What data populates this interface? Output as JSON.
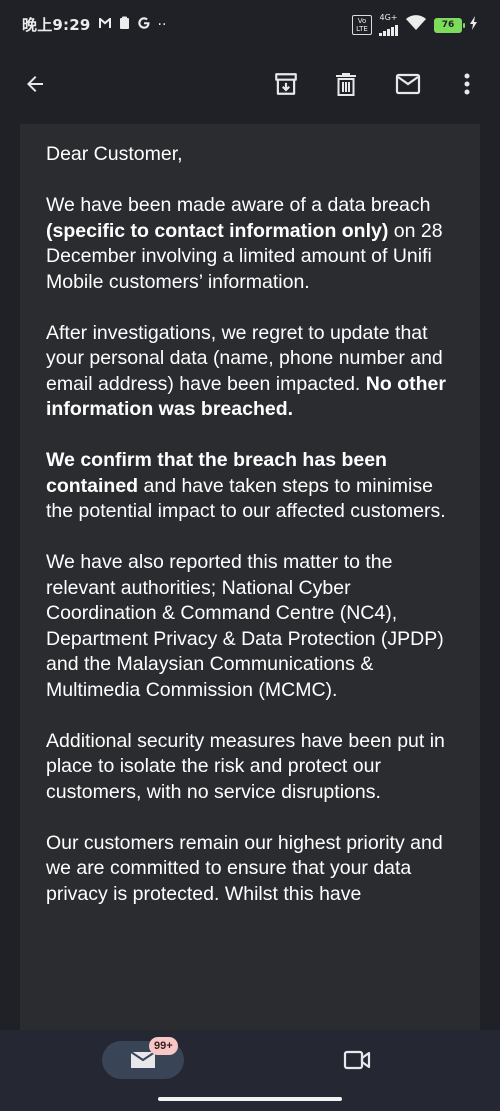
{
  "status_bar": {
    "time": "晚上9:29",
    "volte": "Vo LTE",
    "network": "4G+",
    "battery": "76"
  },
  "app_bar": {
    "back_icon": "arrow-left-icon",
    "archive_icon": "archive-icon",
    "delete_icon": "trash-icon",
    "mark_unread_icon": "mail-icon",
    "more_icon": "more-vert-icon"
  },
  "email": {
    "greeting": "Dear Customer,",
    "p1_a": "We have been made aware of a data breach ",
    "p1_b": "(specific to contact information only)",
    "p1_c": " on 28 December involving a limited amount of Unifi Mobile customers’ information.",
    "p2_a": "After investigations, we regret to update that your personal data (name, phone number and email address) have been impacted. ",
    "p2_b": "No other information was breached.",
    "p3_a": "We confirm that the breach has been contained",
    "p3_b": " and have taken steps to minimise the potential impact to our affected customers.",
    "p4": "We have also reported this matter to the relevant authorities; National Cyber Coordination & Command Centre (NC4), Department Privacy & Data Protection (JPDP) and the Malaysian Communications & Multimedia Commission (MCMC).",
    "p5": "Additional security measures have been put in place to isolate the risk and protect our customers, with no service disruptions.",
    "p6": "Our customers remain our highest priority and we are committed to ensure that your data privacy is protected. Whilst this have"
  },
  "bottom_nav": {
    "mail_badge": "99+",
    "mail_icon": "mail-icon",
    "meet_icon": "video-camera-icon"
  },
  "colors": {
    "background": "#1f2126",
    "card": "#2b2c30",
    "bottom_bar": "#252832",
    "battery": "#7ddc5c",
    "badge": "#f7c6c6"
  }
}
